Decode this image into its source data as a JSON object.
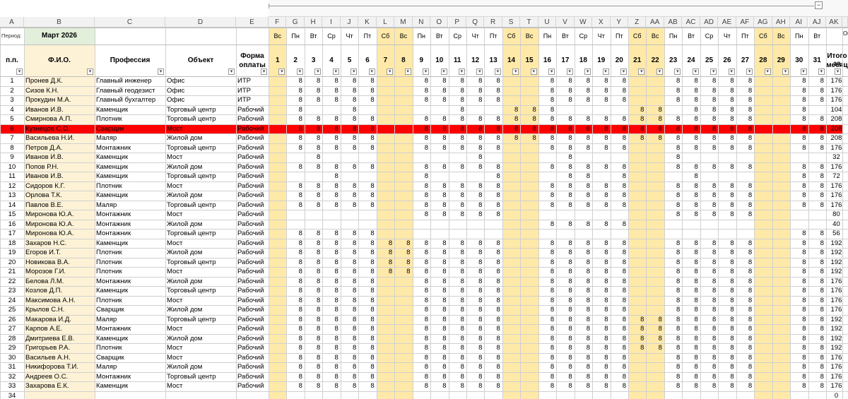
{
  "columns": [
    "A",
    "B",
    "C",
    "D",
    "E",
    "F",
    "G",
    "H",
    "I",
    "J",
    "K",
    "L",
    "M",
    "N",
    "O",
    "P",
    "Q",
    "R",
    "S",
    "T",
    "U",
    "V",
    "W",
    "X",
    "Y",
    "Z",
    "AA",
    "AB",
    "AC",
    "AD",
    "AE",
    "AF",
    "AG",
    "AH",
    "AI",
    "AJ",
    "AK"
  ],
  "period_label": "Период:",
  "period_value": "Март 2026",
  "weekdays": [
    "Вс",
    "Пн",
    "Вт",
    "Ср",
    "Чт",
    "Пт",
    "Сб",
    "Вс",
    "Пн",
    "Вт",
    "Ср",
    "Чт",
    "Пт",
    "Сб",
    "Вс",
    "Пн",
    "Вт",
    "Ср",
    "Чт",
    "Пт",
    "Сб",
    "Вс",
    "Пн",
    "Вт",
    "Ср",
    "Чт",
    "Пт",
    "Сб",
    "Вс",
    "Пн",
    "Вт"
  ],
  "days": [
    "1",
    "2",
    "3",
    "4",
    "5",
    "6",
    "7",
    "8",
    "9",
    "10",
    "11",
    "12",
    "13",
    "14",
    "15",
    "16",
    "17",
    "18",
    "19",
    "20",
    "21",
    "22",
    "23",
    "24",
    "25",
    "26",
    "27",
    "28",
    "29",
    "30",
    "31"
  ],
  "weekend_days": [
    1,
    7,
    8,
    14,
    15,
    21,
    22,
    28,
    29
  ],
  "headers": {
    "num": "п.п.",
    "fio": "Ф.И.О.",
    "prof": "Профессия",
    "obj": "Объект",
    "form1": "Форма",
    "form2": "оплаты",
    "total1": "Итого за",
    "total2": "месяц",
    "extra": "Ок"
  },
  "rows": [
    {
      "n": "1",
      "fio": "Пронев Д.К.",
      "prof": "Главный инженер",
      "obj": "Офис",
      "form": "ИТР",
      "hours": {
        "2": 8,
        "3": 8,
        "4": 8,
        "5": 8,
        "6": 8,
        "9": 8,
        "10": 8,
        "11": 8,
        "12": 8,
        "13": 8,
        "16": 8,
        "17": 8,
        "18": 8,
        "19": 8,
        "20": 8,
        "23": 8,
        "24": 8,
        "25": 8,
        "26": 8,
        "27": 8,
        "30": 8,
        "31": 8
      },
      "total": "176"
    },
    {
      "n": "2",
      "fio": "Сизов К.Н.",
      "prof": "Главный геодезист",
      "obj": "Офис",
      "form": "ИТР",
      "hours": {
        "2": 8,
        "3": 8,
        "4": 8,
        "5": 8,
        "6": 8,
        "9": 8,
        "10": 8,
        "11": 8,
        "12": 8,
        "13": 8,
        "16": 8,
        "17": 8,
        "18": 8,
        "19": 8,
        "20": 8,
        "23": 8,
        "24": 8,
        "25": 8,
        "26": 8,
        "27": 8,
        "30": 8,
        "31": 8
      },
      "total": "176"
    },
    {
      "n": "3",
      "fio": "Прокудин М.А.",
      "prof": "Главный бухгалтер",
      "obj": "Офис",
      "form": "ИТР",
      "hours": {
        "2": 8,
        "3": 8,
        "4": 8,
        "5": 8,
        "6": 8,
        "9": 8,
        "10": 8,
        "11": 8,
        "12": 8,
        "13": 8,
        "16": 8,
        "17": 8,
        "18": 8,
        "19": 8,
        "20": 8,
        "23": 8,
        "24": 8,
        "25": 8,
        "26": 8,
        "27": 8,
        "30": 8,
        "31": 8
      },
      "total": "176"
    },
    {
      "n": "4",
      "fio": "Иванов И.В.",
      "prof": "Каменщик",
      "obj": "Торговый центр",
      "form": "Рабочий",
      "hours": {
        "2": 8,
        "5": 8,
        "11": 8,
        "14": 8,
        "15": 8,
        "16": 8,
        "21": 8,
        "22": 8,
        "24": 8,
        "25": 8,
        "26": 8,
        "27": 8,
        "30": 8
      },
      "total": "104"
    },
    {
      "n": "5",
      "fio": "Смирнова А.П.",
      "prof": "Плотник",
      "obj": "Торговый центр",
      "form": "Рабочий",
      "hours": {
        "2": 8,
        "3": 8,
        "4": 8,
        "5": 8,
        "6": 8,
        "9": 8,
        "10": 8,
        "11": 8,
        "12": 8,
        "13": 8,
        "14": 8,
        "15": 8,
        "16": 8,
        "17": 8,
        "18": 8,
        "19": 8,
        "20": 8,
        "21": 8,
        "22": 8,
        "23": 8,
        "24": 8,
        "25": 8,
        "26": 8,
        "27": 8,
        "30": 8,
        "31": 8
      },
      "total": "208"
    },
    {
      "n": "6",
      "fio": "Кузнецов С.О.",
      "prof": "Сварщик",
      "obj": "Мост",
      "form": "Рабочий",
      "hours": {
        "2": 8,
        "3": 8,
        "4": 8,
        "5": 8,
        "6": 8,
        "9": 8,
        "10": 8,
        "11": 8,
        "12": 8,
        "13": 8,
        "14": 8,
        "15": 8,
        "16": 8,
        "17": 8,
        "18": 8,
        "19": 8,
        "20": 8,
        "21": 8,
        "22": 8,
        "23": 8,
        "24": 8,
        "25": 8,
        "26": 8,
        "27": 8,
        "30": 8,
        "31": 8
      },
      "total": "208",
      "highlight": true
    },
    {
      "n": "7",
      "fio": "Васильева Н.И.",
      "prof": "Маляр",
      "obj": "Жилой дом",
      "form": "Рабочий",
      "hours": {
        "2": 8,
        "3": 8,
        "4": 8,
        "5": 8,
        "6": 8,
        "9": 8,
        "10": 8,
        "11": 8,
        "12": 8,
        "13": 8,
        "14": 8,
        "15": 8,
        "16": 8,
        "17": 8,
        "18": 8,
        "19": 8,
        "20": 8,
        "21": 8,
        "22": 8,
        "23": 8,
        "24": 8,
        "25": 8,
        "26": 8,
        "27": 8,
        "30": 8,
        "31": 8
      },
      "total": "208"
    },
    {
      "n": "8",
      "fio": "Петров Д.А.",
      "prof": "Монтажник",
      "obj": "Торговый центр",
      "form": "Рабочий",
      "hours": {
        "2": 8,
        "3": 8,
        "4": 8,
        "5": 8,
        "6": 8,
        "9": 8,
        "10": 8,
        "11": 8,
        "12": 8,
        "13": 8,
        "16": 8,
        "17": 8,
        "18": 8,
        "19": 8,
        "20": 8,
        "23": 8,
        "24": 8,
        "25": 8,
        "26": 8,
        "27": 8,
        "30": 8,
        "31": 8
      },
      "total": "176"
    },
    {
      "n": "9",
      "fio": "Иванов И.В.",
      "prof": "Каменщик",
      "obj": "Мост",
      "form": "Рабочий",
      "hours": {
        "3": 8,
        "12": 8,
        "17": 8,
        "23": 8
      },
      "total": "32"
    },
    {
      "n": "10",
      "fio": "Попов Р.Н.",
      "prof": "Каменщик",
      "obj": "Жилой дом",
      "form": "Рабочий",
      "hours": {
        "2": 8,
        "3": 8,
        "4": 8,
        "5": 8,
        "6": 8,
        "9": 8,
        "10": 8,
        "11": 8,
        "12": 8,
        "13": 8,
        "16": 8,
        "17": 8,
        "18": 8,
        "19": 8,
        "20": 8,
        "23": 8,
        "24": 8,
        "25": 8,
        "26": 8,
        "27": 8,
        "30": 8,
        "31": 8
      },
      "total": "176"
    },
    {
      "n": "11",
      "fio": "Иванов И.В.",
      "prof": "Каменщик",
      "obj": "Торговый центр",
      "form": "Рабочий",
      "hours": {
        "4": 8,
        "9": 8,
        "13": 8,
        "17": 8,
        "18": 8,
        "20": 8,
        "24": 8,
        "30": 8,
        "31": 8
      },
      "total": "72"
    },
    {
      "n": "12",
      "fio": "Сидоров К.Г.",
      "prof": "Плотник",
      "obj": "Мост",
      "form": "Рабочий",
      "hours": {
        "2": 8,
        "3": 8,
        "4": 8,
        "5": 8,
        "6": 8,
        "9": 8,
        "10": 8,
        "11": 8,
        "12": 8,
        "13": 8,
        "16": 8,
        "17": 8,
        "18": 8,
        "19": 8,
        "20": 8,
        "23": 8,
        "24": 8,
        "25": 8,
        "26": 8,
        "27": 8,
        "30": 8,
        "31": 8
      },
      "total": "176"
    },
    {
      "n": "13",
      "fio": "Орлова Т.К.",
      "prof": "Каменщик",
      "obj": "Жилой дом",
      "form": "Рабочий",
      "hours": {
        "2": 8,
        "3": 8,
        "4": 8,
        "5": 8,
        "6": 8,
        "9": 8,
        "10": 8,
        "11": 8,
        "12": 8,
        "13": 8,
        "16": 8,
        "17": 8,
        "18": 8,
        "19": 8,
        "20": 8,
        "23": 8,
        "24": 8,
        "25": 8,
        "26": 8,
        "27": 8,
        "30": 8,
        "31": 8
      },
      "total": "176"
    },
    {
      "n": "14",
      "fio": "Павлов В.Е.",
      "prof": "Маляр",
      "obj": "Торговый центр",
      "form": "Рабочий",
      "hours": {
        "2": 8,
        "3": 8,
        "4": 8,
        "5": 8,
        "6": 8,
        "9": 8,
        "10": 8,
        "11": 8,
        "12": 8,
        "13": 8,
        "16": 8,
        "17": 8,
        "18": 8,
        "19": 8,
        "20": 8,
        "23": 8,
        "24": 8,
        "25": 8,
        "26": 8,
        "27": 8,
        "30": 8,
        "31": 8
      },
      "total": "176"
    },
    {
      "n": "15",
      "fio": "Миронова Ю.А.",
      "prof": "Монтажник",
      "obj": "Мост",
      "form": "Рабочий",
      "hours": {
        "9": 8,
        "10": 8,
        "11": 8,
        "12": 8,
        "13": 8,
        "23": 8,
        "24": 8,
        "25": 8,
        "26": 8,
        "27": 8
      },
      "total": "80"
    },
    {
      "n": "16",
      "fio": "Миронова Ю.А.",
      "prof": "Монтажник",
      "obj": "Жилой дом",
      "form": "Рабочий",
      "hours": {
        "16": 8,
        "17": 8,
        "18": 8,
        "19": 8,
        "20": 8
      },
      "total": "40"
    },
    {
      "n": "17",
      "fio": "Миронова Ю.А.",
      "prof": "Монтажник",
      "obj": "Торговый центр",
      "form": "Рабочий",
      "hours": {
        "2": 8,
        "3": 8,
        "4": 8,
        "5": 8,
        "6": 8,
        "30": 8,
        "31": 8
      },
      "total": "56"
    },
    {
      "n": "18",
      "fio": "Захаров Н.С.",
      "prof": "Каменщик",
      "obj": "Мост",
      "form": "Рабочий",
      "hours": {
        "2": 8,
        "3": 8,
        "4": 8,
        "5": 8,
        "6": 8,
        "7": 8,
        "8": 8,
        "9": 8,
        "10": 8,
        "11": 8,
        "12": 8,
        "13": 8,
        "16": 8,
        "17": 8,
        "18": 8,
        "19": 8,
        "20": 8,
        "23": 8,
        "24": 8,
        "25": 8,
        "26": 8,
        "27": 8,
        "30": 8,
        "31": 8
      },
      "total": "192"
    },
    {
      "n": "19",
      "fio": "Егоров И.Т.",
      "prof": "Плотник",
      "obj": "Жилой дом",
      "form": "Рабочий",
      "hours": {
        "2": 8,
        "3": 8,
        "4": 8,
        "5": 8,
        "6": 8,
        "7": 8,
        "8": 8,
        "9": 8,
        "10": 8,
        "11": 8,
        "12": 8,
        "13": 8,
        "16": 8,
        "17": 8,
        "18": 8,
        "19": 8,
        "20": 8,
        "23": 8,
        "24": 8,
        "25": 8,
        "26": 8,
        "27": 8,
        "30": 8,
        "31": 8
      },
      "total": "192"
    },
    {
      "n": "20",
      "fio": "Новикова В.А.",
      "prof": "Плотник",
      "obj": "Торговый центр",
      "form": "Рабочий",
      "hours": {
        "2": 8,
        "3": 8,
        "4": 8,
        "5": 8,
        "6": 8,
        "7": 8,
        "8": 8,
        "9": 8,
        "10": 8,
        "11": 8,
        "12": 8,
        "13": 8,
        "16": 8,
        "17": 8,
        "18": 8,
        "19": 8,
        "20": 8,
        "23": 8,
        "24": 8,
        "25": 8,
        "26": 8,
        "27": 8,
        "30": 8,
        "31": 8
      },
      "total": "192"
    },
    {
      "n": "21",
      "fio": "Морозов Г.И.",
      "prof": "Плотник",
      "obj": "Мост",
      "form": "Рабочий",
      "hours": {
        "2": 8,
        "3": 8,
        "4": 8,
        "5": 8,
        "6": 8,
        "7": 8,
        "8": 8,
        "9": 8,
        "10": 8,
        "11": 8,
        "12": 8,
        "13": 8,
        "16": 8,
        "17": 8,
        "18": 8,
        "19": 8,
        "20": 8,
        "23": 8,
        "24": 8,
        "25": 8,
        "26": 8,
        "27": 8,
        "30": 8,
        "31": 8
      },
      "total": "192"
    },
    {
      "n": "22",
      "fio": "Белова Л.М.",
      "prof": "Монтажник",
      "obj": "Жилой дом",
      "form": "Рабочий",
      "hours": {
        "2": 8,
        "3": 8,
        "4": 8,
        "5": 8,
        "6": 8,
        "9": 8,
        "10": 8,
        "11": 8,
        "12": 8,
        "13": 8,
        "16": 8,
        "17": 8,
        "18": 8,
        "19": 8,
        "20": 8,
        "23": 8,
        "24": 8,
        "25": 8,
        "26": 8,
        "27": 8,
        "30": 8,
        "31": 8
      },
      "total": "176"
    },
    {
      "n": "23",
      "fio": "Козлов Д.П.",
      "prof": "Каменщик",
      "obj": "Торговый центр",
      "form": "Рабочий",
      "hours": {
        "2": 8,
        "3": 8,
        "4": 8,
        "5": 8,
        "6": 8,
        "9": 8,
        "10": 8,
        "11": 8,
        "12": 8,
        "13": 8,
        "16": 8,
        "17": 8,
        "18": 8,
        "19": 8,
        "20": 8,
        "23": 8,
        "24": 8,
        "25": 8,
        "26": 8,
        "27": 8,
        "30": 8,
        "31": 8
      },
      "total": "176"
    },
    {
      "n": "24",
      "fio": "Максимова А.Н.",
      "prof": "Плотник",
      "obj": "Мост",
      "form": "Рабочий",
      "hours": {
        "2": 8,
        "3": 8,
        "4": 8,
        "5": 8,
        "6": 8,
        "9": 8,
        "10": 8,
        "11": 8,
        "12": 8,
        "13": 8,
        "16": 8,
        "17": 8,
        "18": 8,
        "19": 8,
        "20": 8,
        "23": 8,
        "24": 8,
        "25": 8,
        "26": 8,
        "27": 8,
        "30": 8,
        "31": 8
      },
      "total": "176"
    },
    {
      "n": "25",
      "fio": "Крылов С.Н.",
      "prof": "Сварщик",
      "obj": "Жилой дом",
      "form": "Рабочий",
      "hours": {
        "2": 8,
        "3": 8,
        "4": 8,
        "5": 8,
        "6": 8,
        "9": 8,
        "10": 8,
        "11": 8,
        "12": 8,
        "13": 8,
        "16": 8,
        "17": 8,
        "18": 8,
        "19": 8,
        "20": 8,
        "23": 8,
        "24": 8,
        "25": 8,
        "26": 8,
        "27": 8,
        "30": 8,
        "31": 8
      },
      "total": "176"
    },
    {
      "n": "26",
      "fio": "Макарова И.Д.",
      "prof": "Маляр",
      "obj": "Торговый центр",
      "form": "Рабочий",
      "hours": {
        "2": 8,
        "3": 8,
        "4": 8,
        "5": 8,
        "6": 8,
        "9": 8,
        "10": 8,
        "11": 8,
        "12": 8,
        "13": 8,
        "16": 8,
        "17": 8,
        "18": 8,
        "19": 8,
        "20": 8,
        "21": 8,
        "22": 8,
        "23": 8,
        "24": 8,
        "25": 8,
        "26": 8,
        "27": 8,
        "30": 8,
        "31": 8
      },
      "total": "192"
    },
    {
      "n": "27",
      "fio": "Карпов А.Е.",
      "prof": "Монтажник",
      "obj": "Мост",
      "form": "Рабочий",
      "hours": {
        "2": 8,
        "3": 8,
        "4": 8,
        "5": 8,
        "6": 8,
        "9": 8,
        "10": 8,
        "11": 8,
        "12": 8,
        "13": 8,
        "16": 8,
        "17": 8,
        "18": 8,
        "19": 8,
        "20": 8,
        "21": 8,
        "22": 8,
        "23": 8,
        "24": 8,
        "25": 8,
        "26": 8,
        "27": 8,
        "30": 8,
        "31": 8
      },
      "total": "192"
    },
    {
      "n": "28",
      "fio": "Дмитриева Е.В.",
      "prof": "Каменщик",
      "obj": "Жилой дом",
      "form": "Рабочий",
      "hours": {
        "2": 8,
        "3": 8,
        "4": 8,
        "5": 8,
        "6": 8,
        "9": 8,
        "10": 8,
        "11": 8,
        "12": 8,
        "13": 8,
        "16": 8,
        "17": 8,
        "18": 8,
        "19": 8,
        "20": 8,
        "21": 8,
        "22": 8,
        "23": 8,
        "24": 8,
        "25": 8,
        "26": 8,
        "27": 8,
        "30": 8,
        "31": 8
      },
      "total": "192"
    },
    {
      "n": "29",
      "fio": "Григорьев Р.А.",
      "prof": "Плотник",
      "obj": "Мост",
      "form": "Рабочий",
      "hours": {
        "2": 8,
        "3": 8,
        "4": 8,
        "5": 8,
        "6": 8,
        "9": 8,
        "10": 8,
        "11": 8,
        "12": 8,
        "13": 8,
        "16": 8,
        "17": 8,
        "18": 8,
        "19": 8,
        "20": 8,
        "21": 8,
        "22": 8,
        "23": 8,
        "24": 8,
        "25": 8,
        "26": 8,
        "27": 8,
        "30": 8,
        "31": 8
      },
      "total": "192"
    },
    {
      "n": "30",
      "fio": "Васильев А.Н.",
      "prof": "Сварщик",
      "obj": "Мост",
      "form": "Рабочий",
      "hours": {
        "2": 8,
        "3": 8,
        "4": 8,
        "5": 8,
        "6": 8,
        "9": 8,
        "10": 8,
        "11": 8,
        "12": 8,
        "13": 8,
        "16": 8,
        "17": 8,
        "18": 8,
        "19": 8,
        "20": 8,
        "23": 8,
        "24": 8,
        "25": 8,
        "26": 8,
        "27": 8,
        "30": 8,
        "31": 8
      },
      "total": "176"
    },
    {
      "n": "31",
      "fio": "Никифорова Т.И.",
      "prof": "Маляр",
      "obj": "Жилой дом",
      "form": "Рабочий",
      "hours": {
        "2": 8,
        "3": 8,
        "4": 8,
        "5": 8,
        "6": 8,
        "9": 8,
        "10": 8,
        "11": 8,
        "12": 8,
        "13": 8,
        "16": 8,
        "17": 8,
        "18": 8,
        "19": 8,
        "20": 8,
        "23": 8,
        "24": 8,
        "25": 8,
        "26": 8,
        "27": 8,
        "30": 8,
        "31": 8
      },
      "total": "176"
    },
    {
      "n": "32",
      "fio": "Андреев О.С.",
      "prof": "Монтажник",
      "obj": "Торговый центр",
      "form": "Рабочий",
      "hours": {
        "2": 8,
        "3": 8,
        "4": 8,
        "5": 8,
        "6": 8,
        "9": 8,
        "10": 8,
        "11": 8,
        "12": 8,
        "13": 8,
        "16": 8,
        "17": 8,
        "18": 8,
        "19": 8,
        "20": 8,
        "23": 8,
        "24": 8,
        "25": 8,
        "26": 8,
        "27": 8,
        "30": 8,
        "31": 8
      },
      "total": "176"
    },
    {
      "n": "33",
      "fio": "Захарова Е.К.",
      "prof": "Каменщик",
      "obj": "Мост",
      "form": "Рабочий",
      "hours": {
        "2": 8,
        "3": 8,
        "4": 8,
        "5": 8,
        "6": 8,
        "9": 8,
        "10": 8,
        "11": 8,
        "12": 8,
        "13": 8,
        "16": 8,
        "17": 8,
        "18": 8,
        "19": 8,
        "20": 8,
        "23": 8,
        "24": 8,
        "25": 8,
        "26": 8,
        "27": 8,
        "30": 8,
        "31": 8
      },
      "total": "176"
    },
    {
      "n": "34",
      "fio": "",
      "prof": "",
      "obj": "",
      "form": "",
      "hours": {},
      "total": "0"
    }
  ],
  "colors": {
    "weekend": "#ffe9a8",
    "name_bg": "#fdf2d6",
    "period_bg": "#e2efda",
    "highlight": "#ff0000",
    "grid": "#d0d0d0",
    "header_bg": "#f2f2f2"
  }
}
